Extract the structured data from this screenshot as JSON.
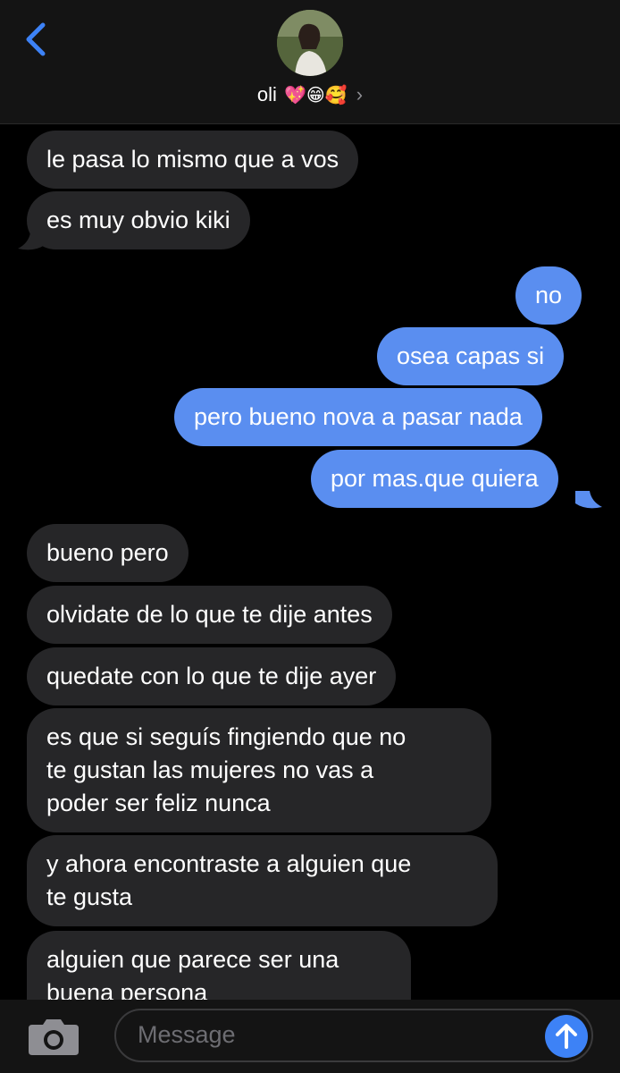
{
  "contact": {
    "name": "oli",
    "emojis": "💖😁🥰",
    "chevron": "›"
  },
  "messages": [
    {
      "side": "in",
      "text": "le pasa lo mismo que a vos"
    },
    {
      "side": "in",
      "text": "es muy obvio kiki"
    },
    {
      "side": "out",
      "text": "no"
    },
    {
      "side": "out",
      "text": "osea capas si"
    },
    {
      "side": "out",
      "text": "pero bueno nova a pasar nada"
    },
    {
      "side": "out",
      "text": "por mas.que quiera"
    },
    {
      "side": "in",
      "text": "bueno pero"
    },
    {
      "side": "in",
      "text": "olvidate de lo que te dije antes"
    },
    {
      "side": "in",
      "text": "quedate con lo que te dije ayer"
    },
    {
      "side": "in",
      "lines": [
        "es que si seguís fingiendo que no",
        "te gustan las mujeres no vas a",
        "poder ser feliz nunca"
      ]
    },
    {
      "side": "in",
      "lines": [
        "y ahora encontraste a alguien que",
        "te gusta"
      ]
    },
    {
      "side": "in",
      "lines": [
        "alguien que parece ser una",
        "buena persona"
      ]
    }
  ],
  "composer": {
    "placeholder": "Message"
  },
  "colors": {
    "outgoing": "#5a8ef0",
    "incoming": "#262628",
    "accent": "#3d82f6"
  }
}
